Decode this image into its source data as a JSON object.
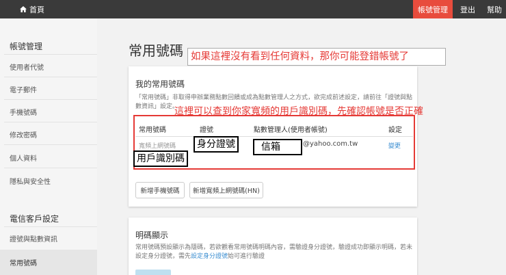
{
  "topbar": {
    "home_label": "首頁",
    "account_label": "帳號管理",
    "logout_label": "登出",
    "help_label": "幫助"
  },
  "sidebar": {
    "section1_title": "帳號管理",
    "section1_items": [
      "使用者代號",
      "電子郵件",
      "手機號碼",
      "修改密碼",
      "個人資料",
      "隱私與安全性"
    ],
    "section2_title": "電信客戶設定",
    "section2_items": [
      "證號與點數資訊",
      "常用號碼"
    ],
    "active_item": "常用號碼"
  },
  "main": {
    "title": "常用號碼",
    "annotation_top": "如果這裡沒有看到任何資料，那你可能登錯帳號了",
    "annotation_mid": "這裡可以查到你家寬頻的用戶識別碼，先確認帳號是否正確"
  },
  "card1": {
    "title": "我的常用號碼",
    "desc_line1": "「常用號碼」非取得申辦業務點數回饋或成為點數管理人之方式，欲完成前述設定，請前往「證號與點",
    "desc_line2": "數資訊」設定。",
    "table": {
      "headers": [
        "常用號碼",
        "證號",
        "點數管理人(使用者帳號)",
        "設定"
      ],
      "row": {
        "number_type": "寬頻上網號碼",
        "email_suffix": "@yahoo.com.tw",
        "action": "變更"
      }
    },
    "labels": {
      "id": "身分證號",
      "email": "信箱",
      "user_code": "用戶識別碼"
    },
    "buttons": [
      "新增手機號碼",
      "新增寬頻上網號碼(HN)"
    ]
  },
  "card2": {
    "title": "明碼顯示",
    "desc_line1": "常用號碼預設顯示為隱碼，若欲觀看常用號碼明碼內容，需驗證身分證號，驗證成功即顯示明碼，若未",
    "desc_line2_pre": "設定身分證號，需先",
    "desc_line2_link": "設定身分證號",
    "desc_line2_post": "始可進行驗證"
  }
}
